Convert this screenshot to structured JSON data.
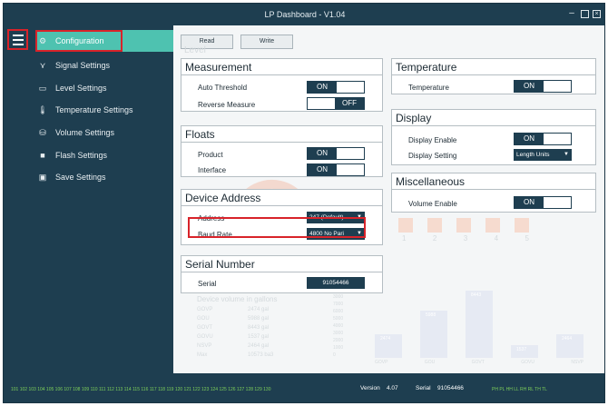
{
  "window": {
    "title": "LP Dashboard - V1.04",
    "controls": {
      "minimize": "–",
      "maximize": "□",
      "close": "✕"
    }
  },
  "sidebar": {
    "items": [
      {
        "label": "Configuration",
        "icon": "gear-icon"
      },
      {
        "label": "Signal Settings",
        "icon": "signal-icon"
      },
      {
        "label": "Level Settings",
        "icon": "level-icon"
      },
      {
        "label": "Temperature Settings",
        "icon": "thermometer-icon"
      },
      {
        "label": "Volume Settings",
        "icon": "volume-icon"
      },
      {
        "label": "Flash Settings",
        "icon": "flash-icon"
      },
      {
        "label": "Save Settings",
        "icon": "save-icon"
      }
    ]
  },
  "toolbar": {
    "read_label": "Read",
    "write_label": "Write"
  },
  "background": {
    "level": "Level",
    "device_volume": "Device volume in gallons",
    "volume_rows": [
      {
        "label": "GOVP",
        "value": "2474 gal"
      },
      {
        "label": "GOU",
        "value": "5988 gal"
      },
      {
        "label": "GOVT",
        "value": "8443 gal"
      },
      {
        "label": "GOVU",
        "value": "1537 gal"
      },
      {
        "label": "NSVP",
        "value": "2464 gal"
      },
      {
        "label": "Max",
        "value": "10573 ba3"
      }
    ],
    "float_numbers": [
      "1",
      "2",
      "3",
      "4",
      "5"
    ],
    "bar_labels": [
      "GOVP",
      "GOU",
      "GOVT",
      "GOVU",
      "NSVP"
    ],
    "bar_values": [
      "2474",
      "5988",
      "8443",
      "1537",
      "2464"
    ],
    "y_ticks": [
      "3000",
      "7000",
      "6000",
      "5000",
      "4000",
      "3000",
      "2000",
      "1000",
      "0"
    ]
  },
  "measurement": {
    "title": "Measurement",
    "auto_threshold_label": "Auto Threshold",
    "auto_threshold_value": "ON",
    "reverse_measure_label": "Reverse Measure",
    "reverse_measure_value": "OFF"
  },
  "floats": {
    "title": "Floats",
    "product_label": "Product",
    "product_value": "ON",
    "interface_label": "Interface",
    "interface_value": "ON"
  },
  "device_address": {
    "title": "Device Address",
    "address_label": "Address",
    "address_value": "247 (Default)",
    "baud_label": "Baud Rate",
    "baud_value": "4800 No Pari"
  },
  "serial_number": {
    "title": "Serial Number",
    "serial_label": "Serial",
    "serial_value": "91054466"
  },
  "temperature": {
    "title": "Temperature",
    "temperature_label": "Temperature",
    "temperature_value": "ON"
  },
  "display": {
    "title": "Display",
    "enable_label": "Display Enable",
    "enable_value": "ON",
    "setting_label": "Display Setting",
    "setting_value": "Length Units"
  },
  "miscellaneous": {
    "title": "Miscellaneous",
    "volume_enable_label": "Volume Enable",
    "volume_enable_value": "ON"
  },
  "statusbar": {
    "addresses": "101 102 103 104 105 106 107 108 109 110 111 112 113 114 115 116 117 118 119 120 121 122 123 124 125 126 127 128 129 130",
    "version_label": "Version",
    "version_value": "4.07",
    "serial_label": "Serial",
    "serial_value": "91054466",
    "indicators": "PH  PL  HH  LL  RH  RL  TH  TL"
  },
  "colors": {
    "chrome": "#1e3e50",
    "accent": "#4ec2b0",
    "highlight": "#d8232a",
    "status_text": "#7ecf5a"
  }
}
